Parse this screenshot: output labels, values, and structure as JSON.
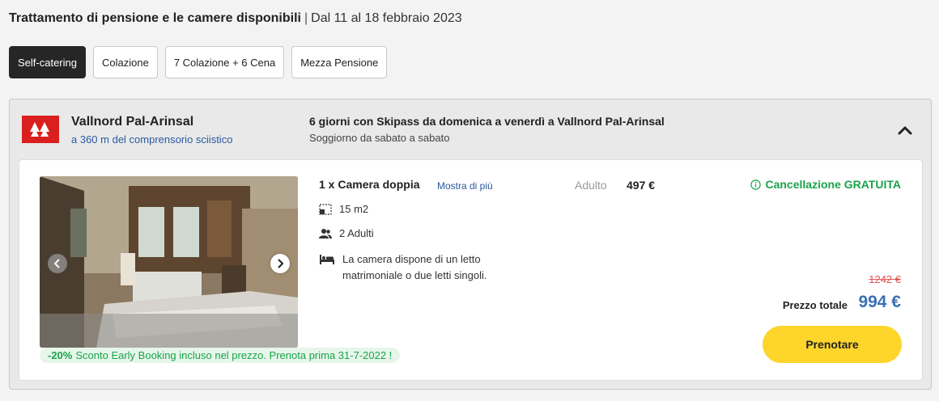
{
  "header": {
    "title": "Trattamento di pensione e le camere disponibili",
    "separator": "|",
    "dates": "Dal 11 al 18 febbraio 2023"
  },
  "board_options": [
    {
      "label": "Self-catering",
      "selected": true
    },
    {
      "label": "Colazione",
      "selected": false
    },
    {
      "label": "7 Colazione + 6 Cena",
      "selected": false
    },
    {
      "label": "Mezza Pensione",
      "selected": false
    }
  ],
  "resort": {
    "name": "Vallnord Pal-Arinsal",
    "distance": "a 360 m del comprensorio sciistico",
    "logo_color": "#d9201f"
  },
  "package": {
    "title": "6 giorni con Skipass da domenica a venerdì a Vallnord Pal-Arinsal",
    "subtitle": "Soggiorno da sabato a sabato"
  },
  "room": {
    "title": "1 x Camera doppia",
    "show_more": "Mostra di più",
    "area": "15 m2",
    "guests": "2 Adulti",
    "bed_description": "La camera dispone di un letto matrimoniale o due letti singoli.",
    "icons": [
      "area-icon",
      "people-icon",
      "bed-icon"
    ]
  },
  "pricing": {
    "adult_label": "Adulto",
    "adult_price": "497 €",
    "cancellation": "Cancellazione GRATUITA",
    "old_price": "1242 €",
    "total_label": "Prezzo totale",
    "total_price": "994 €",
    "book_label": "Prenotare"
  },
  "promo": {
    "discount": "-20%",
    "text": "Sconto Early Booking incluso nel prezzo. Prenota prima 31-7-2022 !"
  },
  "colors": {
    "accent_blue": "#3b6fb5",
    "green": "#1aa34a",
    "book_yellow": "#fdd52b",
    "old_price_red": "#e25555"
  }
}
